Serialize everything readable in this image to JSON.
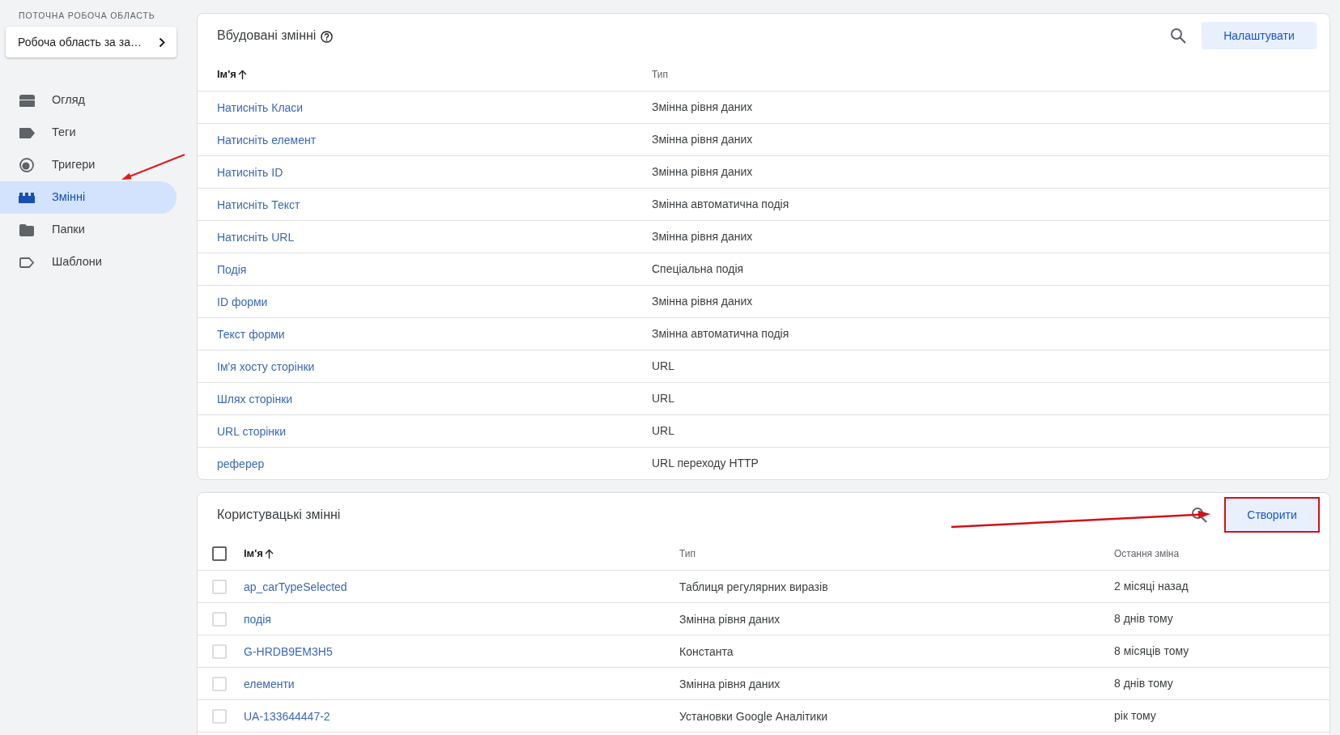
{
  "sidebar": {
    "workspace_label": "ПОТОЧНА РОБОЧА ОБЛАСТЬ",
    "workspace": "Робоча область за за…",
    "annotation_arrow": true,
    "items": [
      {
        "label": "Огляд",
        "kind": "overview",
        "selected": false
      },
      {
        "label": "Теги",
        "kind": "tags",
        "selected": false
      },
      {
        "label": "Тригери",
        "kind": "triggers",
        "selected": false
      },
      {
        "label": "Змінні",
        "kind": "variables",
        "selected": true
      },
      {
        "label": "Папки",
        "kind": "folders",
        "selected": false
      },
      {
        "label": "Шаблони",
        "kind": "templates",
        "selected": false
      }
    ]
  },
  "builtin_variables": {
    "title": "Вбудовані змінні",
    "button": "Налаштувати",
    "columns": [
      {
        "label": "Ім'я",
        "sorted": true
      },
      {
        "label": "Тип",
        "sorted": false
      }
    ],
    "rows": [
      {
        "name": "Натисніть Класи",
        "type": "Змінна рівня даних"
      },
      {
        "name": "Натисніть елемент",
        "type": "Змінна рівня даних"
      },
      {
        "name": "Натисніть ID",
        "type": "Змінна рівня даних"
      },
      {
        "name": "Натисніть Текст",
        "type": "Змінна автоматична подія"
      },
      {
        "name": "Натисніть URL",
        "type": "Змінна рівня даних"
      },
      {
        "name": "Подія",
        "type": "Спеціальна подія"
      },
      {
        "name": "ID форми",
        "type": "Змінна рівня даних"
      },
      {
        "name": "Текст форми",
        "type": "Змінна автоматична подія"
      },
      {
        "name": "Ім'я хосту сторінки",
        "type": "URL"
      },
      {
        "name": "Шлях сторінки",
        "type": "URL"
      },
      {
        "name": "URL сторінки",
        "type": "URL"
      },
      {
        "name": "реферер",
        "type": "URL переходу HTTP"
      }
    ]
  },
  "user_variables": {
    "title": "Користувацькі змінні",
    "button": {
      "label": "Створити",
      "highlighted": true,
      "arrow": true
    },
    "select_all": {
      "checked": false
    },
    "columns": [
      {
        "label": "Ім'я",
        "sorted": true
      },
      {
        "label": "Тип",
        "sorted": false
      },
      {
        "label": "Остання зміна",
        "sorted": false
      }
    ],
    "rows": [
      {
        "name": "ap_carTypeSelected",
        "type": "Таблиця регулярних виразів",
        "last_change": "2 місяці назад",
        "checked": false
      },
      {
        "name": "подія",
        "type": "Змінна рівня даних",
        "last_change": "8 днів тому",
        "checked": false
      },
      {
        "name": "G-HRDB9EM3H5",
        "type": "Константа",
        "last_change": "8 місяців тому",
        "checked": false
      },
      {
        "name": "елементи",
        "type": "Змінна рівня даних",
        "last_change": "8 днів тому",
        "checked": false
      },
      {
        "name": "UA-133644447-2",
        "type": "Установки Google Аналітики",
        "last_change": "рік тому",
        "checked": false
      }
    ]
  }
}
